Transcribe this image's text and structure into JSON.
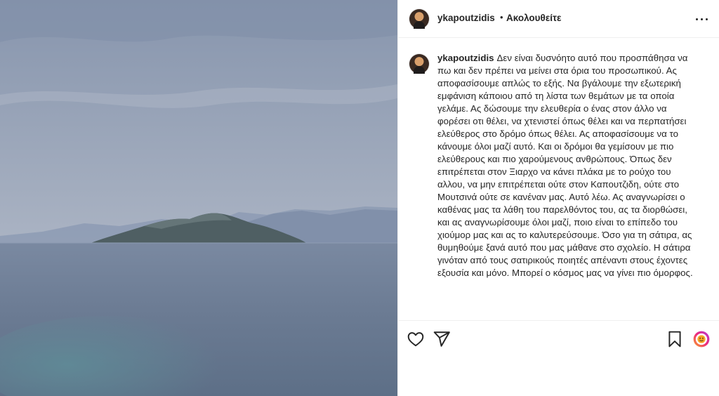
{
  "post": {
    "username": "ykapoutzidis",
    "separator": "•",
    "follow_label": "Ακολουθείτε",
    "caption_username": "ykapoutzidis",
    "caption_text": "Δεν είναι δυσνόητο αυτό που προσπάθησα να πω και δεν πρέπει να μείνει στα όρια του προσωπικού. Ας αποφασίσουμε απλώς το εξής. Να βγάλουμε την εξωτερική εμφάνιση κάποιου από τη λίστα των θεμάτων με τα οποία γελάμε. Ας δώσουμε την ελευθερία ο ένας στον άλλο να φορέσει οτι θέλει, να χτενιστεί όπως θέλει και να περπατήσει ελεύθερος στο δρόμο όπως θέλει. Ας αποφασίσουμε να το κάνουμε όλοι μαζί αυτό. Και οι δρόμοι θα γεμίσουν με πιο ελεύθερους και πιο χαρούμενους ανθρώπους. Όπως δεν επιτρέπεται στον Ξιαρχο να κάνει πλάκα με το ρούχο του αλλου, να μην επιτρέπεται ούτε στον Καπουτζιδη, ούτε στο Μουτσινά ούτε σε κανέναν μας. Αυτό λέω. Ας αναγνωρίσει ο καθένας μας τα λάθη του παρελθόντος του, ας τα διορθώσει, και ας αναγνωρίσουμε όλοι μαζί, ποιο είναι το επίπεδο του χιούμορ μας και ας το καλυτερεύσουμε. Όσο για τη σάτιρα, ας θυμηθούμε ξανά αυτό που μας μάθανε στο σχολείο. Η σάτιρα γινόταν από τους σατιρικούς ποιητές απέναντι στους έχοντες εξουσία και μόνο. Μπορεί ο κόσμος μας να γίνει πιο όμορφος."
  },
  "icons": {
    "more": "more-options-icon",
    "like": "heart-icon",
    "share": "paper-plane-icon",
    "save": "bookmark-icon",
    "reaction": "emoji-icon"
  },
  "colors": {
    "text": "#262626",
    "border": "#efefef",
    "sea": "#6f7f98",
    "sky": "#a6b0c1"
  }
}
